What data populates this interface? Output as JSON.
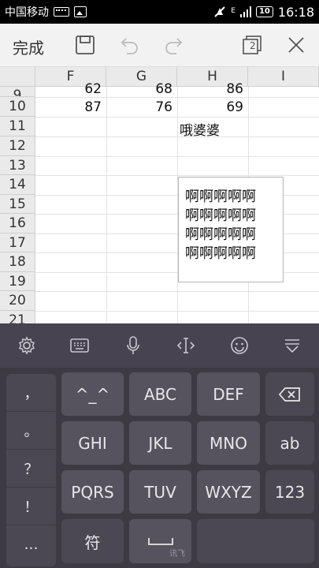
{
  "status_bar": {
    "carrier": "中国移动",
    "battery": "10",
    "time": "16:18",
    "network": "E"
  },
  "toolbar": {
    "done_label": "完成",
    "sheets_count": "2"
  },
  "sheet": {
    "columns": [
      "F",
      "G",
      "H",
      "I"
    ],
    "rows": [
      "9",
      "10",
      "11",
      "12",
      "13",
      "14",
      "15",
      "16",
      "17",
      "18",
      "19",
      "20",
      "21"
    ],
    "row9": {
      "F": "62",
      "G": "68",
      "H": "86"
    },
    "row10": {
      "F": "87",
      "G": "76",
      "H": "69"
    },
    "row11_text": "哦婆婆",
    "textbox_lines": [
      "啊啊啊啊啊",
      "啊啊啊啊啊",
      "啊啊啊啊啊",
      "啊啊啊啊啊"
    ]
  },
  "keyboard": {
    "symbols": [
      "，",
      "。",
      "？",
      "！",
      "…"
    ],
    "keys": {
      "emoticon": "^_^",
      "abc": "ABC",
      "def": "DEF",
      "ghi": "GHI",
      "jkl": "JKL",
      "mno": "MNO",
      "mode_ab": "ab",
      "pqrs": "PQRS",
      "tuv": "TUV",
      "wxyz": "WXYZ",
      "num": "123",
      "fu": "符"
    },
    "brand": "讯飞"
  }
}
